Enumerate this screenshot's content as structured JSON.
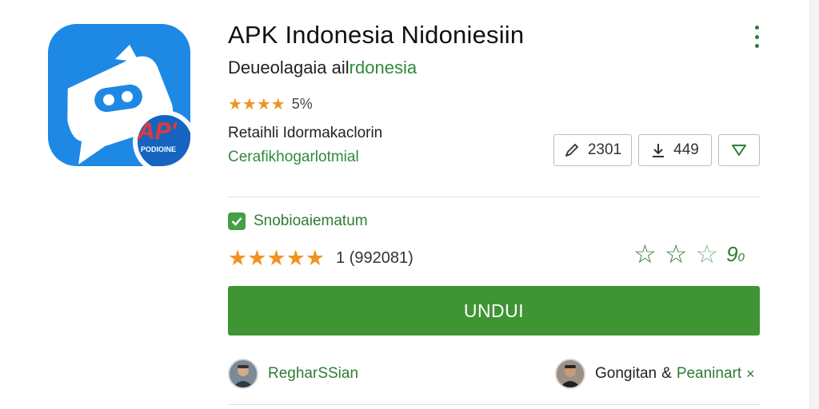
{
  "app": {
    "title": "APK Indonesia Nidoniesiin",
    "developer_prefix": "Deueolagaia ail",
    "developer_accent": "rdonesia",
    "icon_badge": "AP'",
    "icon_badge_sub": "PODIOINE",
    "rating_small_stars": "★★★★",
    "rating_small_value": "5%",
    "info_text": "Retaihli Idormakaclorin",
    "category": "Cerafikhogarlotmial"
  },
  "stats": [
    {
      "icon": "edit-icon",
      "value": "2301"
    },
    {
      "icon": "download-icon",
      "value": "449"
    },
    {
      "icon": "filter-icon",
      "value": ""
    }
  ],
  "verified": {
    "label": "Snobioaiematum"
  },
  "rating": {
    "stars": "★★★★★",
    "count": "1 (992081)",
    "outline_value": "9",
    "outline_suffix": "0"
  },
  "download_button": {
    "label": "UNDUI"
  },
  "people": [
    {
      "name": "RegharSSian"
    },
    {
      "name_part1": "Gongitan",
      "joiner": "&",
      "name_part2": "Peaninart",
      "close": "×"
    }
  ],
  "colors": {
    "accent_green": "#2e7d32",
    "button_green": "#3f9434",
    "icon_blue": "#1e88e5",
    "star_orange": "#f39221"
  }
}
